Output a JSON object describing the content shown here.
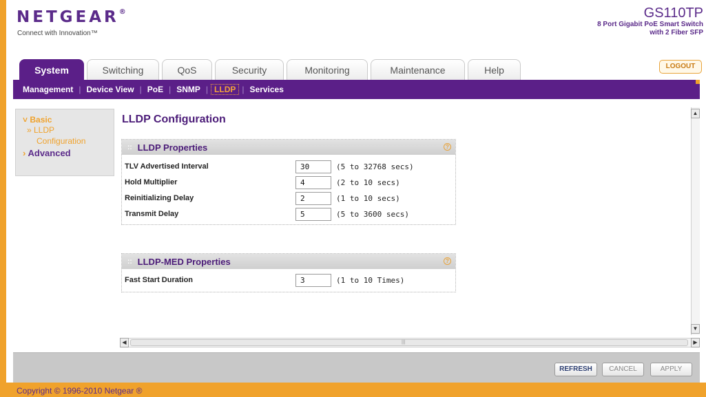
{
  "header": {
    "logo": "NETGEAR",
    "logo_mark": "®",
    "tagline": "Connect with Innovation™",
    "model": "GS110TP",
    "description_line1": "8 Port Gigabit PoE Smart Switch",
    "description_line2": "with 2 Fiber SFP",
    "logout_label": "LOGOUT"
  },
  "tabs": [
    {
      "label": "System",
      "active": true
    },
    {
      "label": "Switching"
    },
    {
      "label": "QoS"
    },
    {
      "label": "Security"
    },
    {
      "label": "Monitoring"
    },
    {
      "label": "Maintenance"
    },
    {
      "label": "Help"
    }
  ],
  "subnav": [
    {
      "label": "Management"
    },
    {
      "label": "Device View"
    },
    {
      "label": "PoE"
    },
    {
      "label": "SNMP"
    },
    {
      "label": "LLDP",
      "active": true
    },
    {
      "label": "Services"
    }
  ],
  "leftmenu": {
    "basic": "Basic",
    "lldp": "» LLDP",
    "configuration": "Configuration",
    "advanced": "Advanced"
  },
  "page": {
    "title": "LLDP Configuration"
  },
  "lldp_properties": {
    "heading": "LLDP Properties",
    "rows": [
      {
        "label": "TLV Advertised Interval",
        "value": "30",
        "range": "(5 to 32768 secs)"
      },
      {
        "label": "Hold Multiplier",
        "value": "4",
        "range": "(2 to 10 secs)"
      },
      {
        "label": "Reinitializing Delay",
        "value": "2",
        "range": "(1 to 10 secs)"
      },
      {
        "label": "Transmit Delay",
        "value": "5",
        "range": "(5 to 3600 secs)"
      }
    ]
  },
  "lldp_med_properties": {
    "heading": "LLDP-MED Properties",
    "rows": [
      {
        "label": "Fast Start Duration",
        "value": "3",
        "range": "(1 to 10 Times)"
      }
    ]
  },
  "buttons": {
    "refresh": "REFRESH",
    "cancel": "CANCEL",
    "apply": "APPLY"
  },
  "footer": {
    "copyright": "Copyright © 1996-2010 Netgear ®"
  }
}
